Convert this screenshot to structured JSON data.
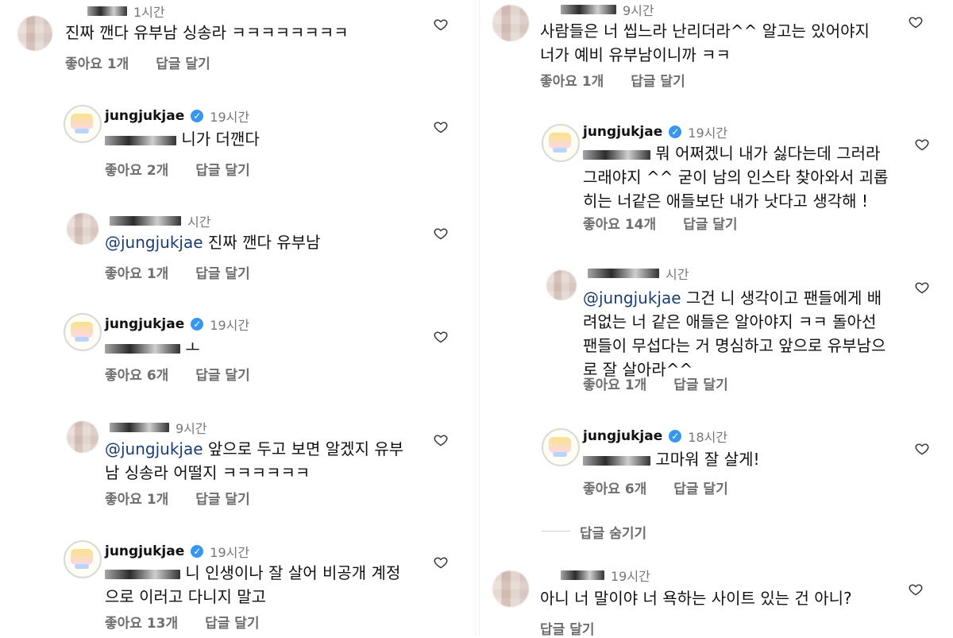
{
  "left": [
    {
      "type": "comment",
      "username": "",
      "time": "1시간",
      "text": "진짜 깬다 유부남 싱송라 ㅋㅋㅋㅋㅋㅋㅋㅋ",
      "likes": "좋아요 1개",
      "reply": "답글 달기"
    },
    {
      "type": "reply",
      "username": "jungjukjae",
      "time": "19시간",
      "text": "니가 더깬다",
      "likes": "좋아요 2개",
      "reply": "답글 달기"
    },
    {
      "type": "comment",
      "username": "",
      "time": "시간",
      "mention": "@jungjukjae",
      "text": "진짜 깬다 유부남",
      "likes": "좋아요 1개",
      "reply": "답글 달기"
    },
    {
      "type": "reply",
      "username": "jungjukjae",
      "time": "19시간",
      "text": "ㅗ",
      "likes": "좋아요 6개",
      "reply": "답글 달기"
    },
    {
      "type": "comment",
      "username": "",
      "time": "9시간",
      "mention": "@jungjukjae",
      "text": "앞으로 두고 보면 알겠지 유부남 싱송라 어떨지 ㅋㅋㅋㅋㅋㅋ",
      "likes": "좋아요 1개",
      "reply": "답글 달기"
    },
    {
      "type": "reply",
      "username": "jungjukjae",
      "time": "19시간",
      "text": "니 인생이나 잘 살어 비공개 계정으로 이러고 다니지 말고",
      "likes": "좋아요 13개",
      "reply": "답글 달기"
    }
  ],
  "right": [
    {
      "type": "comment",
      "username": "",
      "time": "9시간",
      "text": "사람들은 너 씹느라 난리더라^^ 알고는 있어야지 너가 예비 유부남이니까 ㅋㅋ",
      "likes": "좋아요 1개",
      "reply": "답글 달기"
    },
    {
      "type": "reply",
      "username": "jungjukjae",
      "time": "19시간",
      "text": "뭐 어쩌겠니 내가 싫다는데 그러라 그래야지 ^^ 굳이 남의 인스타 찾아와서 괴롭히는 너같은 애들보단 내가 낫다고 생각해 !",
      "likes": "좋아요 14개",
      "reply": "답글 달기"
    },
    {
      "type": "comment",
      "username": "",
      "time": "시간",
      "mention": "@jungjukjae",
      "text": "그건 니 생각이고 팬들에게 배려없는 너 같은 애들은 알아야지 ㅋㅋ 돌아선 팬들이 무섭다는 거 명심하고 앞으로 유부남으로 잘 살아라^^",
      "likes": "좋아요 1개",
      "reply": "답글 달기"
    },
    {
      "type": "reply",
      "username": "jungjukjae",
      "time": "18시간",
      "text": "고마워 잘 살게!",
      "likes": "좋아요 6개",
      "reply": "답글 달기"
    },
    {
      "type": "hide",
      "text": "답글 숨기기"
    },
    {
      "type": "comment",
      "username": "",
      "time": "19시간",
      "text": "아니 너 말이야  너 욕하는 사이트 있는 건 아니?",
      "reply": "답글 달기"
    }
  ],
  "icons": {
    "verified": "verified-badge-icon",
    "heart": "heart-outline-icon"
  },
  "colors": {
    "text": "#111111",
    "muted": "#6e6e6e",
    "mention": "#1a3e73",
    "verified": "#3797f0"
  }
}
